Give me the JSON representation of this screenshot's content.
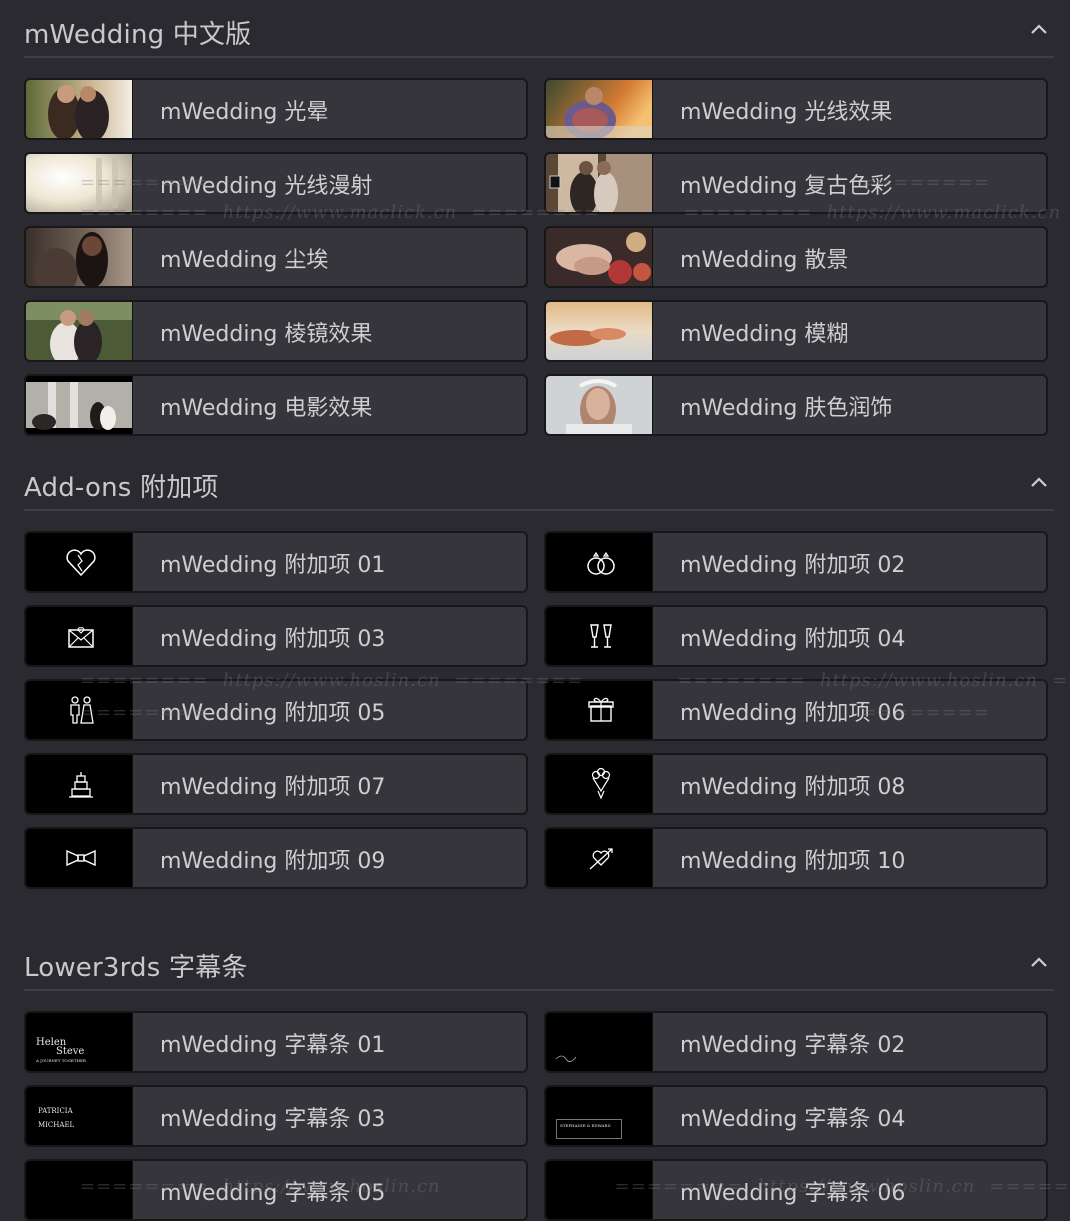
{
  "sections": [
    {
      "title": "mWedding 中文版",
      "items": [
        {
          "label": "mWedding 光晕"
        },
        {
          "label": "mWedding 光线效果"
        },
        {
          "label": "mWedding 光线漫射"
        },
        {
          "label": "mWedding 复古色彩"
        },
        {
          "label": "mWedding 尘埃"
        },
        {
          "label": "mWedding 散景"
        },
        {
          "label": "mWedding 棱镜效果"
        },
        {
          "label": "mWedding 模糊"
        },
        {
          "label": "mWedding 电影效果"
        },
        {
          "label": "mWedding 肤色润饰"
        }
      ]
    },
    {
      "title": "Add-ons 附加项",
      "items": [
        {
          "label": "mWedding 附加项 01",
          "icon": "hearts-icon"
        },
        {
          "label": "mWedding 附加项 02",
          "icon": "rings-icon"
        },
        {
          "label": "mWedding 附加项 03",
          "icon": "love-letter-icon"
        },
        {
          "label": "mWedding 附加项 04",
          "icon": "champagne-glasses-icon"
        },
        {
          "label": "mWedding 附加项 05",
          "icon": "couple-icon"
        },
        {
          "label": "mWedding 附加项 06",
          "icon": "gift-icon"
        },
        {
          "label": "mWedding 附加项 07",
          "icon": "wedding-cake-icon"
        },
        {
          "label": "mWedding 附加项 08",
          "icon": "bouquet-icon"
        },
        {
          "label": "mWedding 附加项 09",
          "icon": "bow-tie-icon"
        },
        {
          "label": "mWedding 附加项 10",
          "icon": "cupid-arrow-icon"
        }
      ]
    },
    {
      "title": "Lower3rds 字幕条",
      "items": [
        {
          "label": "mWedding 字幕条 01"
        },
        {
          "label": "mWedding 字幕条 02"
        },
        {
          "label": "mWedding 字幕条 03"
        },
        {
          "label": "mWedding 字幕条 04"
        },
        {
          "label": "mWedding 字幕条 05"
        },
        {
          "label": "mWedding 字幕条 06"
        }
      ]
    }
  ],
  "lower_thirds": {
    "lt01_line1": "Helen",
    "lt01_line2": "Steve",
    "lt01_line3": "A JOURNEY TOGETHER",
    "lt03_line1": "PATRICIA",
    "lt03_line2": "MICHAEL",
    "lt04_line1": "STEPHANIE & EDWARD"
  },
  "watermarks": {
    "site_a": "https://www.maclick.cn",
    "site_b": "https://www.hoslin.cn",
    "dashes": "========"
  },
  "colors": {
    "background": "#2a2a30",
    "item_bg": "#35353b",
    "text": "#cfcfcf"
  }
}
